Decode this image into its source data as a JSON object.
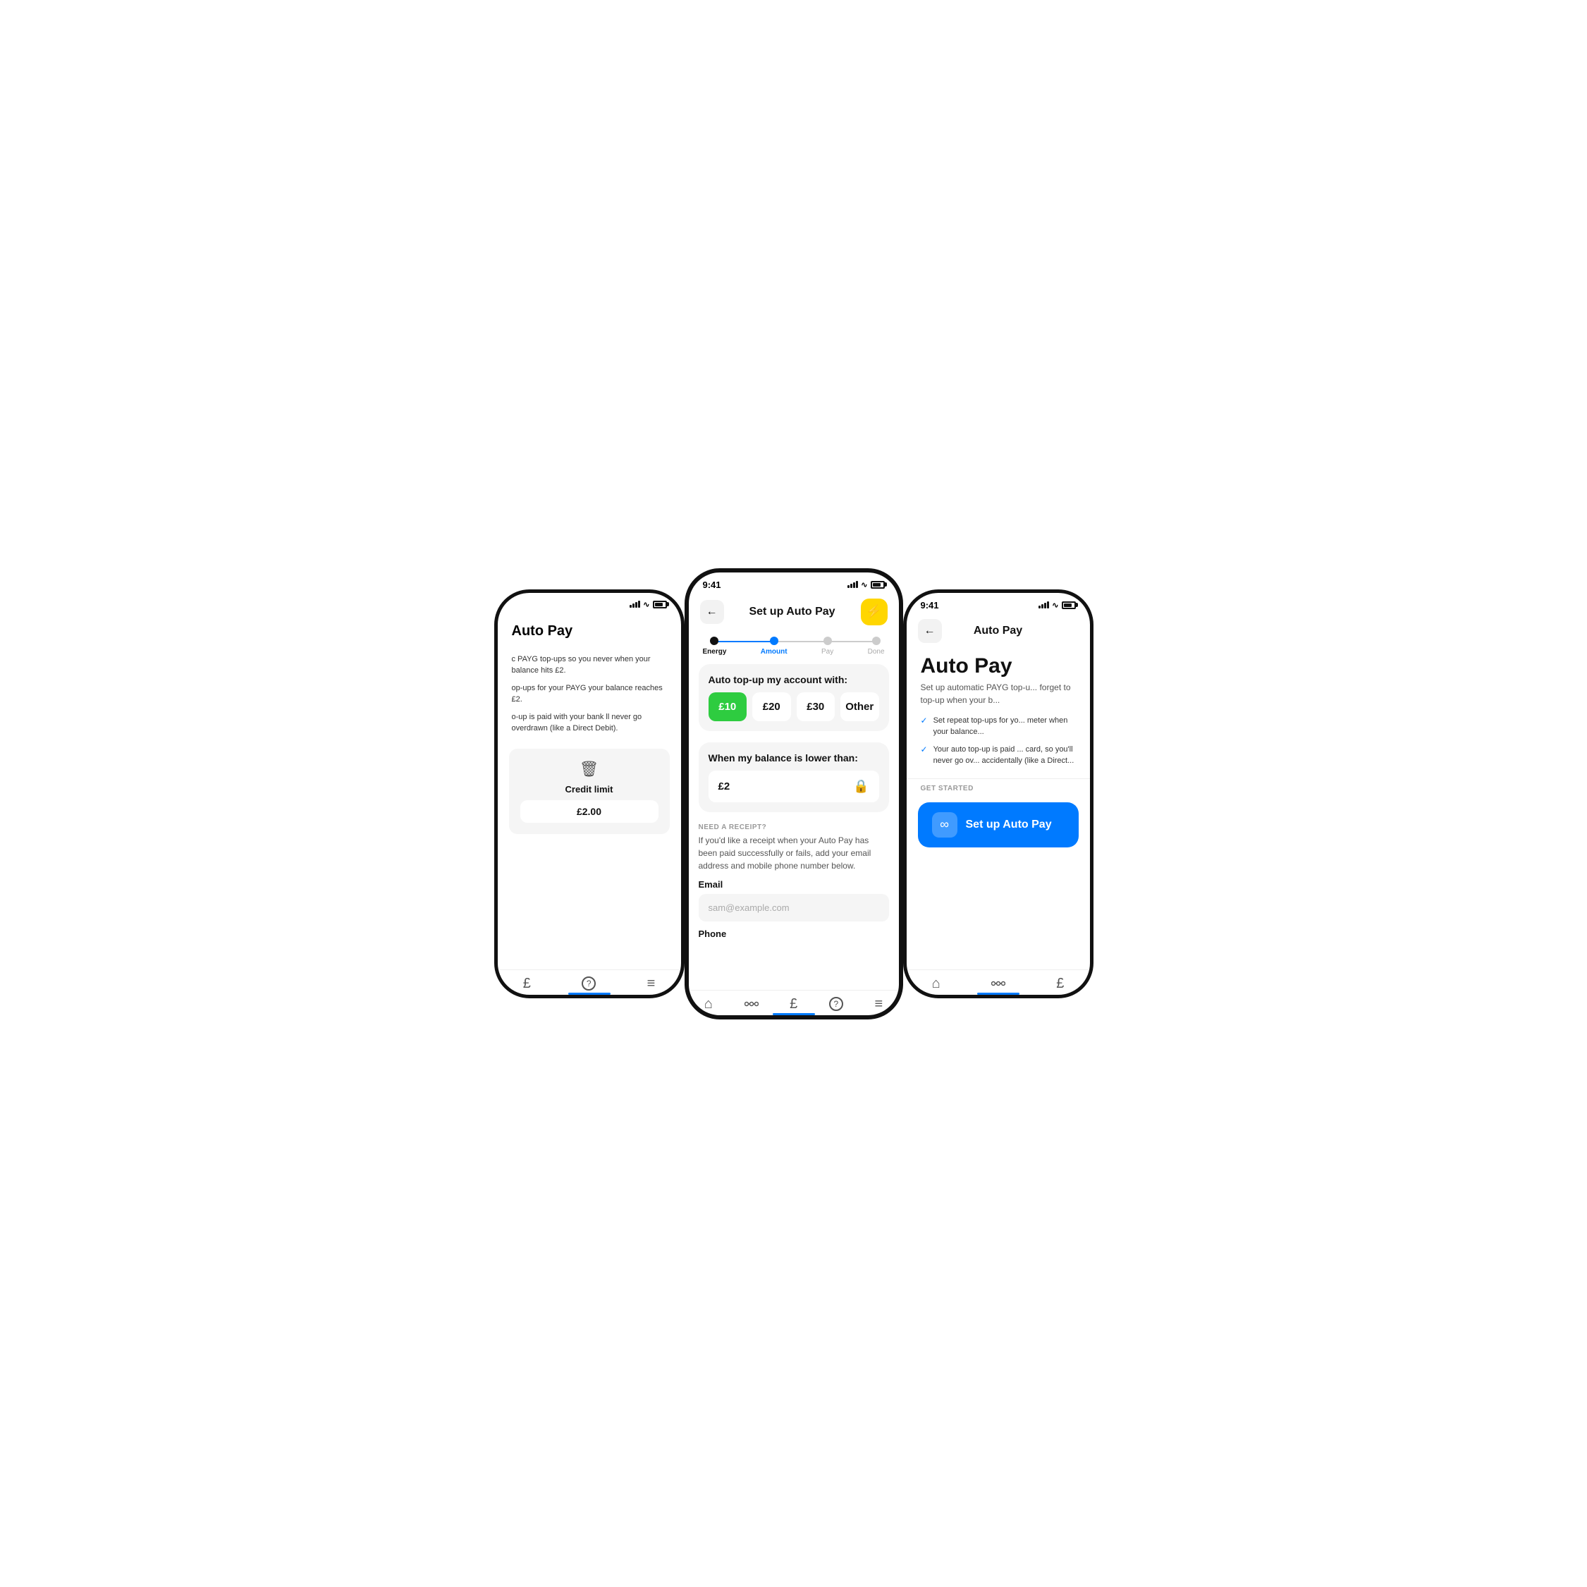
{
  "left_phone": {
    "title": "Auto Pay",
    "body1": "c PAYG top-ups so you never when your balance hits £2.",
    "body2": "op-ups for your PAYG your balance reaches £2.",
    "body3": "o-up is paid with your bank ll never go overdrawn (like a Direct Debit).",
    "credit_limit_label": "Credit limit",
    "credit_limit_value": "£2.00"
  },
  "center_phone": {
    "status_time": "9:41",
    "header_title": "Set up Auto Pay",
    "back_label": "←",
    "steps": [
      {
        "label": "Energy",
        "state": "filled"
      },
      {
        "label": "Amount",
        "state": "active"
      },
      {
        "label": "Pay",
        "state": "inactive"
      },
      {
        "label": "Done",
        "state": "inactive"
      }
    ],
    "topup_title": "Auto top-up my account with:",
    "amounts": [
      {
        "value": "£10",
        "selected": true
      },
      {
        "value": "£20",
        "selected": false
      },
      {
        "value": "£30",
        "selected": false
      },
      {
        "value": "Other",
        "selected": false
      }
    ],
    "balance_title": "When my balance is lower than:",
    "balance_value": "£2",
    "receipt_label": "NEED A RECEIPT?",
    "receipt_text": "If you'd like a receipt when your Auto Pay has been paid successfully or fails, add your email address and mobile phone number below.",
    "email_label": "Email",
    "email_placeholder": "sam@example.com",
    "phone_label": "Phone"
  },
  "right_phone": {
    "status_time": "9:41",
    "header_title": "Auto Pay",
    "back_label": "←",
    "main_title": "Auto Pay",
    "subtitle": "Set up automatic PAYG top-u... forget to top-up when your b...",
    "bullets": [
      "Set repeat top-ups for yo... meter when your balance...",
      "Your auto top-up is paid ... card, so you'll never go ov... accidentally (like a Direct..."
    ],
    "get_started_label": "GET STARTED",
    "setup_btn_label": "Set up Auto Pay"
  },
  "icons": {
    "back": "←",
    "lightning": "⚡",
    "lock": "🔒",
    "trash": "🗑",
    "infinity": "∞",
    "check": "✓"
  }
}
